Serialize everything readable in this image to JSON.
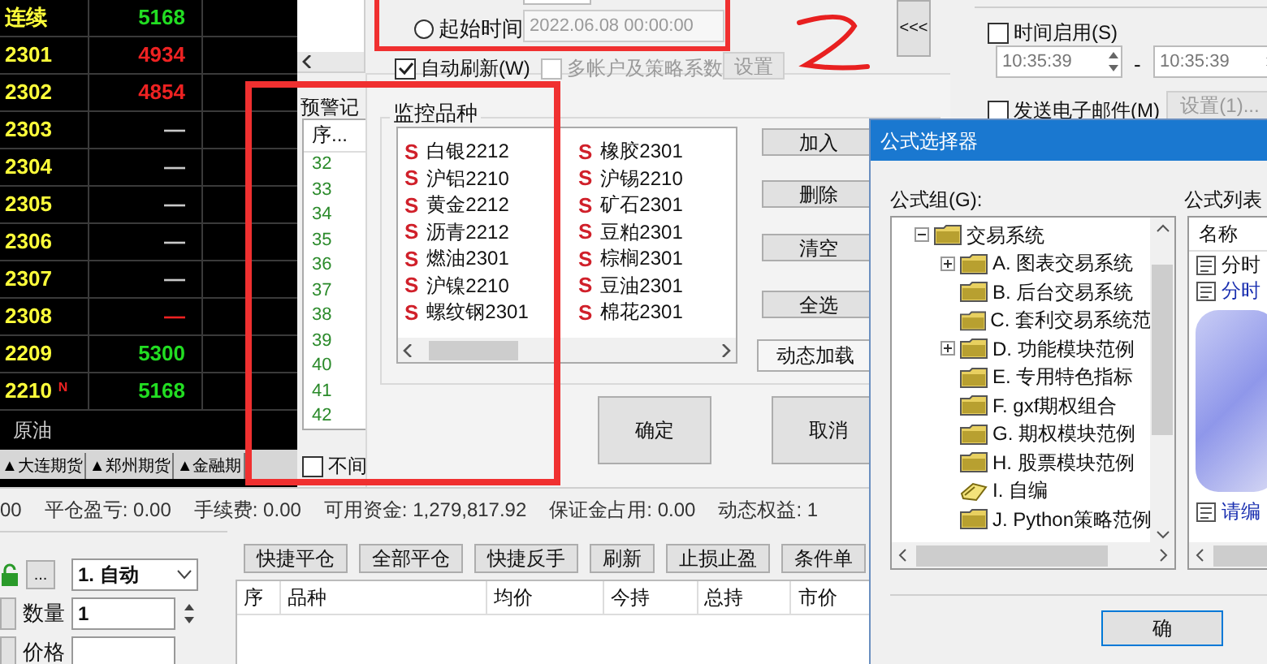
{
  "quotes": {
    "rows": [
      {
        "name": "连续",
        "price": "5168",
        "color": "#22dd22"
      },
      {
        "name": "2301",
        "price": "4934",
        "color": "#ee2222"
      },
      {
        "name": "2302",
        "price": "4854",
        "color": "#ee2222"
      },
      {
        "name": "2303",
        "price": "—",
        "color": "#c8c8c8"
      },
      {
        "name": "2304",
        "price": "—",
        "color": "#c8c8c8"
      },
      {
        "name": "2305",
        "price": "—",
        "color": "#c8c8c8"
      },
      {
        "name": "2306",
        "price": "—",
        "color": "#c8c8c8"
      },
      {
        "name": "2307",
        "price": "—",
        "color": "#c8c8c8"
      },
      {
        "name": "2308",
        "price": "—",
        "color": "#ee2222"
      },
      {
        "name": "2209",
        "price": "5300",
        "color": "#22dd22"
      },
      {
        "name": "2210",
        "price": "5168",
        "color": "#22dd22",
        "badge": "N"
      }
    ],
    "footer": "原油",
    "tabs": [
      "▲大连期货",
      "▲郑州期货",
      "▲金融期"
    ]
  },
  "alert_window": {
    "record_label": "预警记",
    "record_header": "序...",
    "record_rows": [
      "32",
      "33",
      "34",
      "35",
      "36",
      "37",
      "38",
      "39",
      "40",
      "41",
      "42"
    ],
    "no_interval": {
      "label": "不间",
      "checked": false
    },
    "start_time": {
      "label": "起始时间",
      "selected": false,
      "value": "2022.06.08 00:00:00"
    },
    "auto_refresh": {
      "label": "自动刷新(W)",
      "checked": true
    },
    "multi_account": {
      "label": "多帐户及策略系数",
      "checked": false,
      "disabled": true
    },
    "settings_button": {
      "label": "设置",
      "disabled": true
    },
    "collapse_button": "<<<",
    "time_enable": {
      "label": "时间启用(S)",
      "checked": false
    },
    "time_from": "10:35:39",
    "time_separator": "-",
    "time_to": "10:35:39",
    "send_email": {
      "label": "发送电子邮件(M)",
      "checked": false
    },
    "email_settings_button": {
      "label": "设置(1)...",
      "disabled": true
    },
    "monitor": {
      "title": "监控品种",
      "items": [
        {
          "mark": "S",
          "name": "白银2212"
        },
        {
          "mark": "S",
          "name": "橡胶2301"
        },
        {
          "mark": "S",
          "name": "沪铝2210"
        },
        {
          "mark": "S",
          "name": "沪锡2210"
        },
        {
          "mark": "S",
          "name": "黄金2212"
        },
        {
          "mark": "S",
          "name": "矿石2301"
        },
        {
          "mark": "S",
          "name": "沥青2212"
        },
        {
          "mark": "S",
          "name": "豆粕2301"
        },
        {
          "mark": "S",
          "name": "燃油2301"
        },
        {
          "mark": "S",
          "name": "棕榈2301"
        },
        {
          "mark": "S",
          "name": "沪镍2210"
        },
        {
          "mark": "S",
          "name": "豆油2301"
        },
        {
          "mark": "S",
          "name": "螺纹钢2301"
        },
        {
          "mark": "S",
          "name": "棉花2301"
        }
      ]
    },
    "side_buttons": [
      "加入",
      "删除",
      "清空",
      "全选",
      "动态加载"
    ],
    "ok_button": "确定",
    "cancel_button": "取消"
  },
  "trading": {
    "status_bar": [
      "00",
      "平仓盈亏: 0.00",
      "手续费: 0.00",
      "可用资金: 1,279,817.92",
      "保证金占用: 0.00",
      "动态权益: 1"
    ],
    "more_button": "...",
    "mode": "1. 自动",
    "quantity_label": "数量",
    "quantity": "1",
    "price_label": "价格",
    "actions": [
      "快捷平仓",
      "全部平仓",
      "快捷反手",
      "刷新",
      "止损止盈",
      "条件单"
    ],
    "columns": [
      "序",
      "品种",
      "均价",
      "今持",
      "总持",
      "市价"
    ]
  },
  "formula_dialog": {
    "title": "公式选择器",
    "group_label": "公式组(G):",
    "tree": [
      {
        "label": "交易系统",
        "expanded": true,
        "kind": "folder",
        "children": [
          {
            "label": "A. 图表交易系统",
            "expanded": false,
            "kind": "folder"
          },
          {
            "label": "B. 后台交易系统",
            "kind": "folder"
          },
          {
            "label": "C. 套利交易系统范",
            "kind": "folder"
          },
          {
            "label": "D. 功能模块范例",
            "expanded": false,
            "kind": "folder"
          },
          {
            "label": "E. 专用特色指标",
            "kind": "folder"
          },
          {
            "label": "F. gxf期权组合",
            "kind": "folder"
          },
          {
            "label": "G. 期权模块范例",
            "kind": "folder"
          },
          {
            "label": "H. 股票模块范例",
            "kind": "folder"
          },
          {
            "label": "I. 自编",
            "kind": "edit"
          },
          {
            "label": "J. Python策略范例",
            "kind": "folder"
          }
        ]
      }
    ],
    "list_label": "公式列表",
    "list_header": "名称",
    "list_items": [
      {
        "name": "分时",
        "color": "#111111"
      },
      {
        "name": "分时",
        "color": "#1a2fb0"
      },
      {
        "name": "请编",
        "color": "#1a2fb0"
      }
    ],
    "ok_button": "确"
  }
}
